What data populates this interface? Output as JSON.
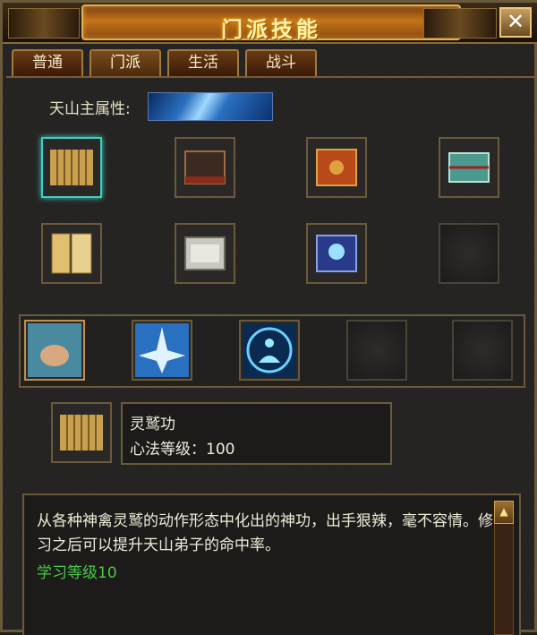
{
  "window": {
    "title": "门派技能",
    "close_icon": "close-icon"
  },
  "tabs": [
    {
      "label": "普通",
      "active": false
    },
    {
      "label": "门派",
      "active": true
    },
    {
      "label": "生活",
      "active": false
    },
    {
      "label": "战斗",
      "active": false
    }
  ],
  "attribute": {
    "label": "天山主属性:",
    "icon": "ice-element-icon"
  },
  "scroll_slots": [
    {
      "icon": "bamboo-scroll-icon",
      "selected": true
    },
    {
      "icon": "dark-tome-icon"
    },
    {
      "icon": "red-tome-icon"
    },
    {
      "icon": "teal-tome-icon"
    },
    {
      "icon": "scripture-book-icon"
    },
    {
      "icon": "silver-scroll-icon"
    },
    {
      "icon": "skull-scroll-icon"
    },
    {
      "icon": "empty-slot"
    }
  ],
  "skill_slots": [
    {
      "icon": "fist-skill-icon"
    },
    {
      "icon": "ice-burst-skill-icon"
    },
    {
      "icon": "meditation-skill-icon"
    },
    {
      "icon": "empty-slot"
    },
    {
      "icon": "empty-slot"
    }
  ],
  "detail": {
    "icon": "bamboo-scroll-icon",
    "name": "灵鹫功",
    "level_text": "心法等级：100"
  },
  "description": {
    "text": "从各种神禽灵鹫的动作形态中化出的神功，出手狠辣，毫不容情。修习之后可以提升天山弟子的命中率。",
    "learn_level": "学习等级10"
  },
  "colors": {
    "accent": "#c47418",
    "selected": "#3ad0c8",
    "learn": "#4ac84a"
  }
}
